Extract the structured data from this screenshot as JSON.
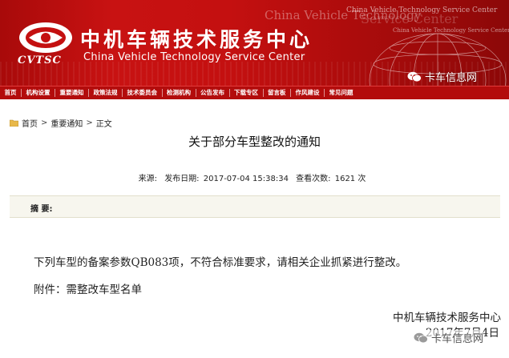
{
  "banner": {
    "org_name_cn": "中机车辆技术服务中心",
    "org_name_en": "China Vehicle Technology Service Center",
    "logo_text": "CVTSC",
    "watermark_1": "China Vehicle Technology",
    "watermark_2": "China Vehicle Technology Service Center",
    "watermark_3": "Service Center",
    "watermark_4": "China Vehicle Technology Service Center",
    "wechat_label": "卡车信息网"
  },
  "nav": {
    "items": [
      "首页",
      "机构设置",
      "重要通知",
      "政策法规",
      "技术委员会",
      "检测机构",
      "公告发布",
      "下载专区",
      "留言板",
      "作风建设",
      "常见问题"
    ]
  },
  "breadcrumb": {
    "home": "首页",
    "section": "重要通知",
    "current": "正文",
    "separator": ">"
  },
  "article": {
    "title": "关于部分车型整改的通知",
    "source_label": "来源:",
    "date_label": "发布日期:",
    "date_value": "2017-07-04 15:38:34",
    "views_label": "查看次数:",
    "views_value": "1621 次",
    "abstract_label": "摘 要:",
    "body": "下列车型的备案参数QB083项，不符合标准要求，请相关企业抓紧进行整改。",
    "attachment": "附件：需整改车型名单",
    "signature_org": "中机车辆技术服务中心",
    "signature_date": "2017年7月4日"
  },
  "footer_watermark": "卡车信息网",
  "colors": {
    "banner_red": "#c41010",
    "nav_red": "#b30c0c",
    "abstract_bg": "#f7f6ee"
  }
}
